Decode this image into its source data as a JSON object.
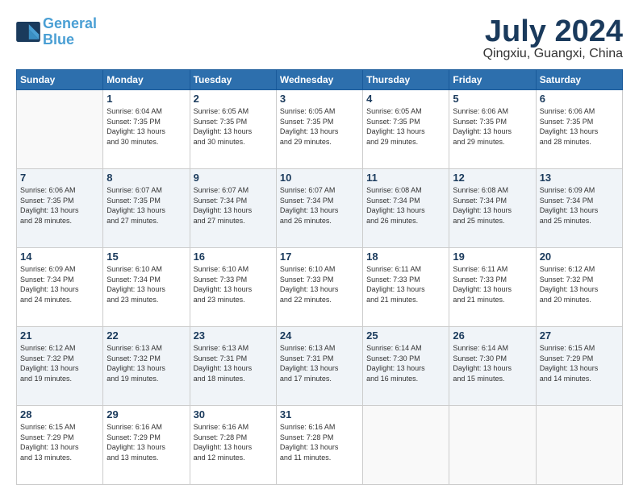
{
  "header": {
    "logo_line1": "General",
    "logo_line2": "Blue",
    "month": "July 2024",
    "location": "Qingxiu, Guangxi, China"
  },
  "weekdays": [
    "Sunday",
    "Monday",
    "Tuesday",
    "Wednesday",
    "Thursday",
    "Friday",
    "Saturday"
  ],
  "weeks": [
    [
      {
        "day": "",
        "info": ""
      },
      {
        "day": "1",
        "info": "Sunrise: 6:04 AM\nSunset: 7:35 PM\nDaylight: 13 hours\nand 30 minutes."
      },
      {
        "day": "2",
        "info": "Sunrise: 6:05 AM\nSunset: 7:35 PM\nDaylight: 13 hours\nand 30 minutes."
      },
      {
        "day": "3",
        "info": "Sunrise: 6:05 AM\nSunset: 7:35 PM\nDaylight: 13 hours\nand 29 minutes."
      },
      {
        "day": "4",
        "info": "Sunrise: 6:05 AM\nSunset: 7:35 PM\nDaylight: 13 hours\nand 29 minutes."
      },
      {
        "day": "5",
        "info": "Sunrise: 6:06 AM\nSunset: 7:35 PM\nDaylight: 13 hours\nand 29 minutes."
      },
      {
        "day": "6",
        "info": "Sunrise: 6:06 AM\nSunset: 7:35 PM\nDaylight: 13 hours\nand 28 minutes."
      }
    ],
    [
      {
        "day": "7",
        "info": "Sunrise: 6:06 AM\nSunset: 7:35 PM\nDaylight: 13 hours\nand 28 minutes."
      },
      {
        "day": "8",
        "info": "Sunrise: 6:07 AM\nSunset: 7:35 PM\nDaylight: 13 hours\nand 27 minutes."
      },
      {
        "day": "9",
        "info": "Sunrise: 6:07 AM\nSunset: 7:34 PM\nDaylight: 13 hours\nand 27 minutes."
      },
      {
        "day": "10",
        "info": "Sunrise: 6:07 AM\nSunset: 7:34 PM\nDaylight: 13 hours\nand 26 minutes."
      },
      {
        "day": "11",
        "info": "Sunrise: 6:08 AM\nSunset: 7:34 PM\nDaylight: 13 hours\nand 26 minutes."
      },
      {
        "day": "12",
        "info": "Sunrise: 6:08 AM\nSunset: 7:34 PM\nDaylight: 13 hours\nand 25 minutes."
      },
      {
        "day": "13",
        "info": "Sunrise: 6:09 AM\nSunset: 7:34 PM\nDaylight: 13 hours\nand 25 minutes."
      }
    ],
    [
      {
        "day": "14",
        "info": "Sunrise: 6:09 AM\nSunset: 7:34 PM\nDaylight: 13 hours\nand 24 minutes."
      },
      {
        "day": "15",
        "info": "Sunrise: 6:10 AM\nSunset: 7:34 PM\nDaylight: 13 hours\nand 23 minutes."
      },
      {
        "day": "16",
        "info": "Sunrise: 6:10 AM\nSunset: 7:33 PM\nDaylight: 13 hours\nand 23 minutes."
      },
      {
        "day": "17",
        "info": "Sunrise: 6:10 AM\nSunset: 7:33 PM\nDaylight: 13 hours\nand 22 minutes."
      },
      {
        "day": "18",
        "info": "Sunrise: 6:11 AM\nSunset: 7:33 PM\nDaylight: 13 hours\nand 21 minutes."
      },
      {
        "day": "19",
        "info": "Sunrise: 6:11 AM\nSunset: 7:33 PM\nDaylight: 13 hours\nand 21 minutes."
      },
      {
        "day": "20",
        "info": "Sunrise: 6:12 AM\nSunset: 7:32 PM\nDaylight: 13 hours\nand 20 minutes."
      }
    ],
    [
      {
        "day": "21",
        "info": "Sunrise: 6:12 AM\nSunset: 7:32 PM\nDaylight: 13 hours\nand 19 minutes."
      },
      {
        "day": "22",
        "info": "Sunrise: 6:13 AM\nSunset: 7:32 PM\nDaylight: 13 hours\nand 19 minutes."
      },
      {
        "day": "23",
        "info": "Sunrise: 6:13 AM\nSunset: 7:31 PM\nDaylight: 13 hours\nand 18 minutes."
      },
      {
        "day": "24",
        "info": "Sunrise: 6:13 AM\nSunset: 7:31 PM\nDaylight: 13 hours\nand 17 minutes."
      },
      {
        "day": "25",
        "info": "Sunrise: 6:14 AM\nSunset: 7:30 PM\nDaylight: 13 hours\nand 16 minutes."
      },
      {
        "day": "26",
        "info": "Sunrise: 6:14 AM\nSunset: 7:30 PM\nDaylight: 13 hours\nand 15 minutes."
      },
      {
        "day": "27",
        "info": "Sunrise: 6:15 AM\nSunset: 7:29 PM\nDaylight: 13 hours\nand 14 minutes."
      }
    ],
    [
      {
        "day": "28",
        "info": "Sunrise: 6:15 AM\nSunset: 7:29 PM\nDaylight: 13 hours\nand 13 minutes."
      },
      {
        "day": "29",
        "info": "Sunrise: 6:16 AM\nSunset: 7:29 PM\nDaylight: 13 hours\nand 13 minutes."
      },
      {
        "day": "30",
        "info": "Sunrise: 6:16 AM\nSunset: 7:28 PM\nDaylight: 13 hours\nand 12 minutes."
      },
      {
        "day": "31",
        "info": "Sunrise: 6:16 AM\nSunset: 7:28 PM\nDaylight: 13 hours\nand 11 minutes."
      },
      {
        "day": "",
        "info": ""
      },
      {
        "day": "",
        "info": ""
      },
      {
        "day": "",
        "info": ""
      }
    ]
  ]
}
